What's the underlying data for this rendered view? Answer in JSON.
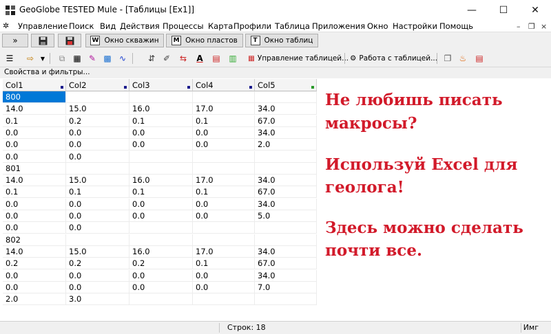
{
  "window": {
    "title": "GeoGlobe TESTED Mule - [Таблицы [Ex1]]",
    "minimize_glyph": "—",
    "maximize_glyph": "☐",
    "close_glyph": "✕"
  },
  "menu": {
    "items": [
      "Управление",
      "Поиск",
      "Вид",
      "Действия",
      "Процессы",
      "Карта",
      "Профили",
      "Таблица",
      "Приложения",
      "Окно",
      "Настройки",
      "Помощь"
    ],
    "mdi_min": "–",
    "mdi_restore": "❐",
    "mdi_close": "×"
  },
  "toolbar1": {
    "expand_label": "»",
    "wells_window": {
      "letter": "W",
      "label": "Окно скважин"
    },
    "layers_window": {
      "letter": "M",
      "label": "Окно пластов"
    },
    "tables_window": {
      "letter": "T",
      "label": "Окно таблиц"
    }
  },
  "toolbar2": {
    "table_mgmt_label": "Управление таблицей...",
    "table_work_label": "Работа с таблицей..."
  },
  "panel": {
    "title": "Свойства и фильтры..."
  },
  "table": {
    "columns": [
      "Col1",
      "Col2",
      "Col3",
      "Col4",
      "Col5"
    ],
    "rows": [
      [
        "800",
        "",
        "",
        "",
        ""
      ],
      [
        "14.0",
        "15.0",
        "16.0",
        "17.0",
        "34.0"
      ],
      [
        "0.1",
        "0.2",
        "0.1",
        "0.1",
        "67.0"
      ],
      [
        "0.0",
        "0.0",
        "0.0",
        "0.0",
        "34.0"
      ],
      [
        "0.0",
        "0.0",
        "0.0",
        "0.0",
        "2.0"
      ],
      [
        "0.0",
        "0.0",
        "",
        "",
        ""
      ],
      [
        "801",
        "",
        "",
        "",
        ""
      ],
      [
        "14.0",
        "15.0",
        "16.0",
        "17.0",
        "34.0"
      ],
      [
        "0.1",
        "0.1",
        "0.1",
        "0.1",
        "67.0"
      ],
      [
        "0.0",
        "0.0",
        "0.0",
        "0.0",
        "34.0"
      ],
      [
        "0.0",
        "0.0",
        "0.0",
        "0.0",
        "5.0"
      ],
      [
        "0.0",
        "0.0",
        "",
        "",
        ""
      ],
      [
        "802",
        "",
        "",
        "",
        ""
      ],
      [
        "14.0",
        "15.0",
        "16.0",
        "17.0",
        "34.0"
      ],
      [
        "0.2",
        "0.2",
        "0.2",
        "0.1",
        "67.0"
      ],
      [
        "0.0",
        "0.0",
        "0.0",
        "0.0",
        "34.0"
      ],
      [
        "0.0",
        "0.0",
        "0.0",
        "0.0",
        "7.0"
      ],
      [
        "2.0",
        "3.0",
        "",
        "",
        ""
      ]
    ]
  },
  "overlay": {
    "line1": "Не любишь писать",
    "line2": "макросы?",
    "line3": "Используй Excel для",
    "line4": "геолога!",
    "line5": "Здесь  можно сделать",
    "line6": "почти все.",
    "color": "#d21a2a"
  },
  "status": {
    "rows_label": "Строк: 18",
    "right_label": "Имг"
  }
}
